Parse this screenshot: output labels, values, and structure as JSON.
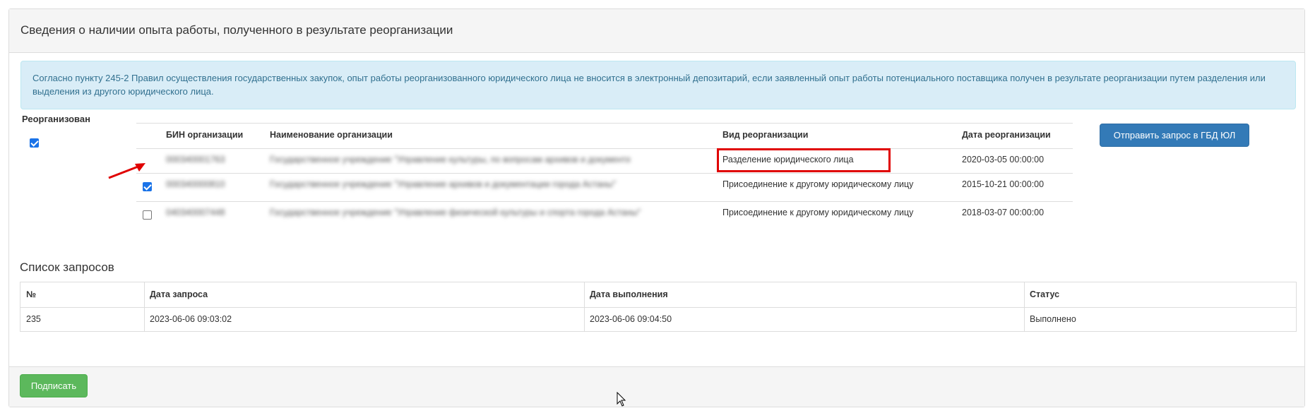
{
  "panel": {
    "title": "Сведения о наличии опыта работы, полученного в результате реорганизации",
    "info_text": "Согласно пункту 245-2 Правил осуществления государственных закупок, опыт работы реорганизованного юридического лица не вносится в электронный депозитарий, если заявленный опыт работы потенциального поставщика получен в результате реорганизации путем разделения или выделения из другого юридического лица."
  },
  "reorganized": {
    "label": "Реорганизован",
    "checked": true
  },
  "org_table": {
    "headers": {
      "bin": "БИН организации",
      "name": "Наименование организации",
      "type": "Вид реорганизации",
      "date": "Дата реорганизации"
    },
    "rows": [
      {
        "checkbox": "none",
        "bin": "000340001763",
        "name": "Государственное учреждение \"Управление культуры, по вопросам архивов и документации\"",
        "type": "Разделение юридического лица",
        "date": "2020-03-05 00:00:00",
        "highlighted": true
      },
      {
        "checkbox": "checked",
        "bin": "000340000810",
        "name": "Государственное учреждение \"Управление архивов и документации города Астаны\"",
        "type": "Присоединение к другому юридическому лицу",
        "date": "2015-10-21 00:00:00",
        "highlighted": false
      },
      {
        "checkbox": "unchecked",
        "bin": "040340007448",
        "name": "Государственное учреждение \"Управление физической культуры и спорта города Астаны\"",
        "type": "Присоединение к другому юридическому лицу",
        "date": "2018-03-07 00:00:00",
        "highlighted": false
      }
    ]
  },
  "send_button": "Отправить запрос в ГБД ЮЛ",
  "requests": {
    "title": "Список запросов",
    "headers": {
      "num": "№",
      "request_date": "Дата запроса",
      "done_date": "Дата выполнения",
      "status": "Статус"
    },
    "rows": [
      {
        "num": "235",
        "request_date": "2023-06-06 09:03:02",
        "done_date": "2023-06-06 09:04:50",
        "status": "Выполнено"
      }
    ]
  },
  "footer": {
    "sign_button": "Подписать"
  },
  "colors": {
    "primary": "#337ab7",
    "success": "#5cb85c",
    "info_bg": "#d9edf7",
    "info_text": "#31708f",
    "highlight": "#e00000",
    "checkbox": "#1a73e8"
  }
}
